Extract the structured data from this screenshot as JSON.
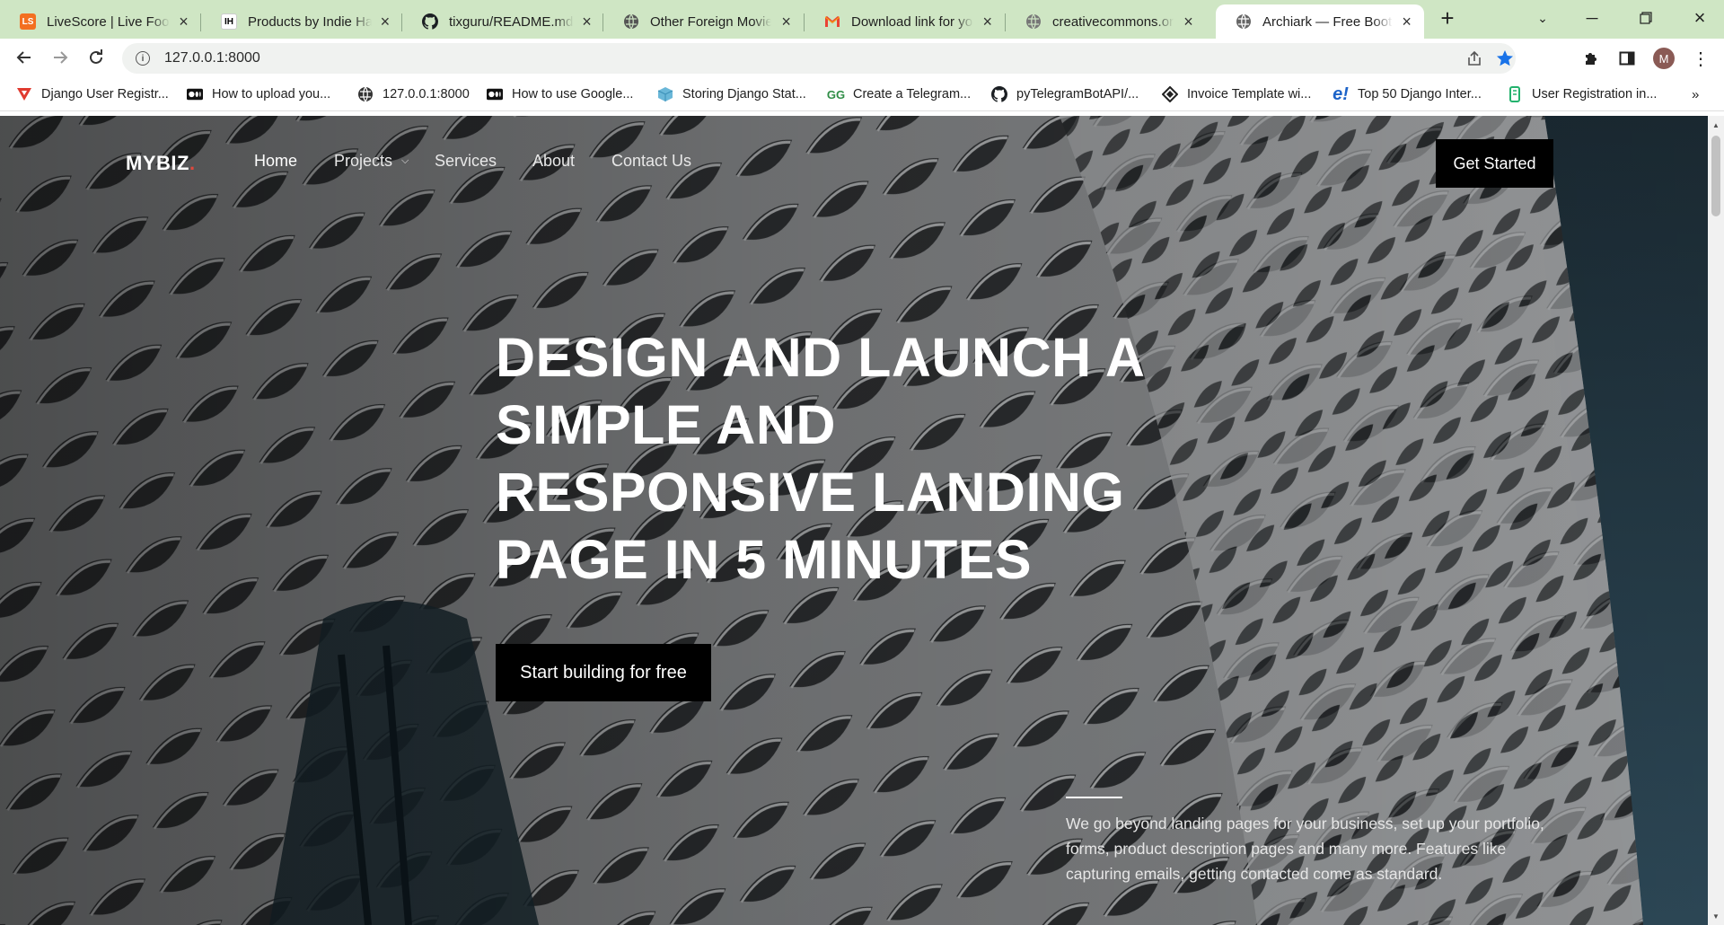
{
  "browser": {
    "tabs": [
      {
        "title": "LiveScore | Live Football",
        "favicon": "livescore-icon",
        "favicon_text": "LS",
        "active": false
      },
      {
        "title": "Products by Indie Hackers",
        "favicon": "indie-hackers-icon",
        "favicon_text": "IH",
        "active": false
      },
      {
        "title": "tixguru/README.md at main",
        "favicon": "github-icon",
        "active": false
      },
      {
        "title": "Other Foreign Movies",
        "favicon": "globe-icon",
        "active": false
      },
      {
        "title": "Download link for your",
        "favicon": "gmail-icon",
        "active": false
      },
      {
        "title": "creativecommons.org",
        "favicon": "globe-icon",
        "active": false
      },
      {
        "title": "Archiark — Free Bootstrap",
        "favicon": "globe-icon",
        "active": true
      }
    ],
    "address": "127.0.0.1:8000",
    "bookmarks": [
      {
        "label": "Django User Registr...",
        "icon": "red-v-icon"
      },
      {
        "label": "How to upload you...",
        "icon": "medium-icon"
      },
      {
        "label": "127.0.0.1:8000",
        "icon": "globe-icon"
      },
      {
        "label": "How to use Google...",
        "icon": "medium-icon"
      },
      {
        "label": "Storing Django Stat...",
        "icon": "cube-icon"
      },
      {
        "label": "Create a Telegram...",
        "icon": "geeks-icon"
      },
      {
        "label": "pyTelegramBotAPI/...",
        "icon": "github-icon"
      },
      {
        "label": "Invoice Template wi...",
        "icon": "diamond-icon"
      },
      {
        "label": "Top 50 Django Inter...",
        "icon": "e-icon"
      },
      {
        "label": "User Registration in...",
        "icon": "green-tag-icon"
      }
    ],
    "profile_initial": "M",
    "colors": {
      "tabstrip": "#cfe6c4",
      "star": "#1a73e8"
    }
  },
  "page": {
    "brand": "MYBIZ",
    "brand_dot": ".",
    "nav": [
      "Home",
      "Projects",
      "Services",
      "About",
      "Contact Us"
    ],
    "cta": "Get Started",
    "headline": [
      "DESIGN AND LAUNCH A",
      "SIMPLE AND",
      "RESPONSIVE LANDING",
      "PAGE IN 5 MINUTES"
    ],
    "hero_button": "Start building for free",
    "blurb": "We go beyond landing pages for your business, set up your portfolio, forms, product description pages and many more. Features like capturing emails, getting contacted come as standard.",
    "colors": {
      "accent_dot": "#e0483d",
      "button": "#000000",
      "text": "#ffffff"
    }
  }
}
